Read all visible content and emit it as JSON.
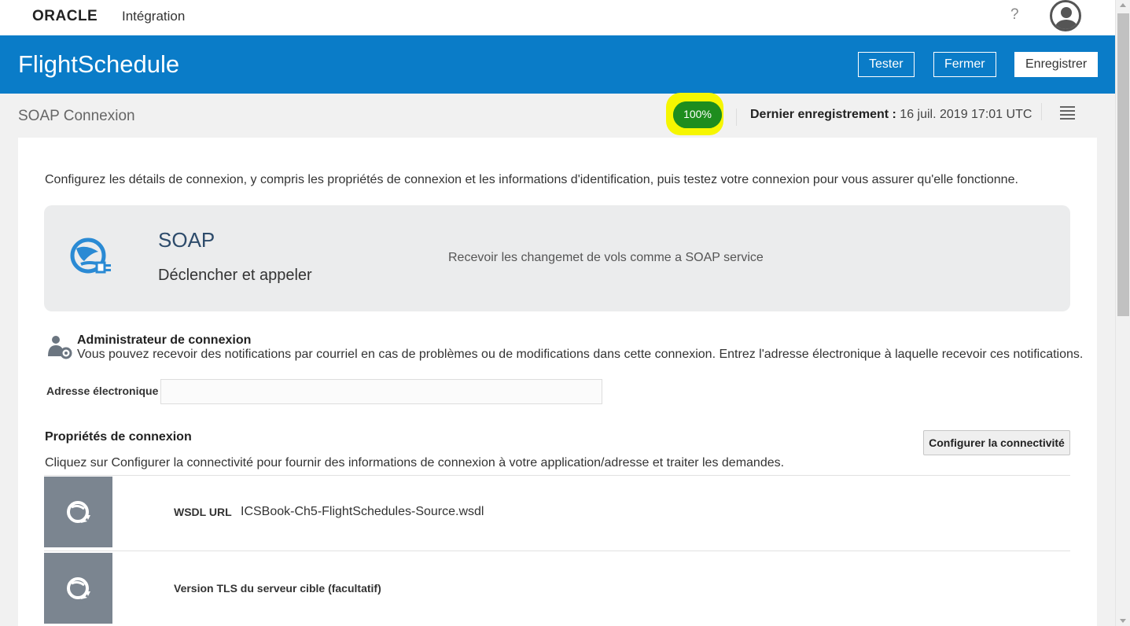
{
  "topbar": {
    "logo_text": "ORACLE",
    "product": "Intégration",
    "help_label": "?"
  },
  "header": {
    "title": "FlightSchedule",
    "test_label": "Tester",
    "close_label": "Fermer",
    "save_label": "Enregistrer"
  },
  "subheader": {
    "title": "SOAP Connexion",
    "progress_text": "100%",
    "progress_value": 1.0,
    "last_save_label": "Dernier enregistrement :",
    "last_save_value": "16 juil. 2019 17:01 UTC"
  },
  "main": {
    "intro": "Configurez les détails de connexion, y compris les propriétés de connexion et les informations d'identification, puis testez votre connexion pour vous assurer qu'elle fonctionne.",
    "adapter": {
      "name": "SOAP",
      "role": "Déclencher et appeler",
      "description": "Recevoir les changemet de vols comme a SOAP service",
      "icon": "soap-globe-plug-icon"
    },
    "admin": {
      "title": "Administrateur de connexion",
      "description": "Vous pouvez recevoir des notifications par courriel en cas de problèmes ou de modifications dans cette connexion. Entrez l'adresse électronique à laquelle recevoir ces notifications.",
      "email_label": "Adresse électronique",
      "email_value": "",
      "email_placeholder": ""
    },
    "properties": {
      "title": "Propriétés de connexion",
      "configure_label": "Configurer la connectivité",
      "description": "Cliquez sur Configurer la connectivité pour fournir des informations de connexion à votre application/adresse et traiter les demandes.",
      "items": [
        {
          "label": "WSDL URL",
          "value": "ICSBook-Ch5-FlightSchedules-Source.wsdl"
        },
        {
          "label": "Version TLS du serveur cible (facultatif)",
          "value": ""
        }
      ]
    }
  },
  "colors": {
    "brand_blue": "#0a7cc8",
    "progress_green": "#1a9a1a",
    "highlight_yellow": "#f6f600",
    "tile_gray": "#7b8590"
  }
}
